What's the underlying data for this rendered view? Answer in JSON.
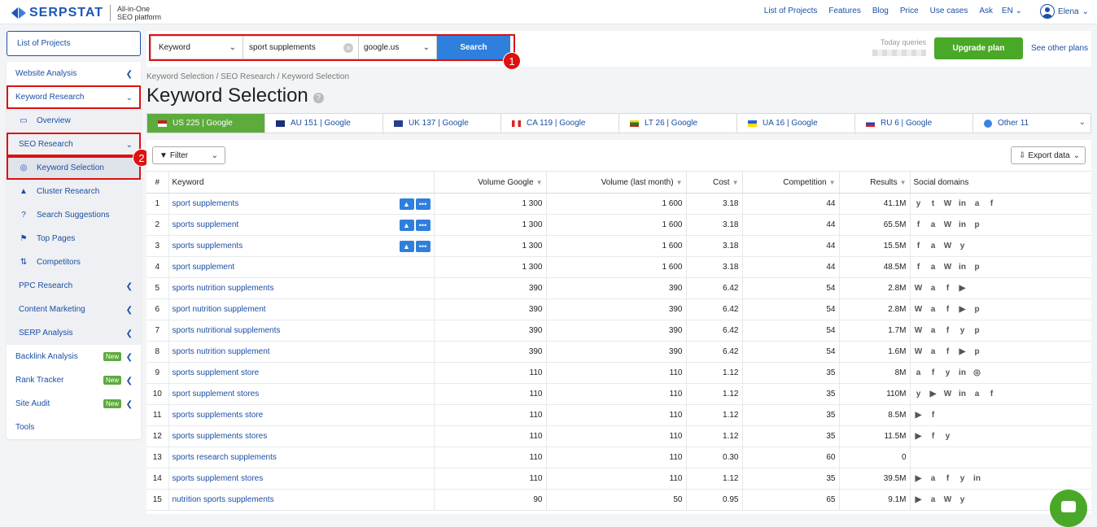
{
  "topbar": {
    "logo": "SERPSTAT",
    "tagline_1": "All-in-One",
    "tagline_2": "SEO platform",
    "nav": [
      "List of Projects",
      "Features",
      "Blog",
      "Price",
      "Use cases",
      "Ask"
    ],
    "lang": "EN",
    "user": "Elena"
  },
  "sidebar": {
    "projects": "List of Projects",
    "items": [
      {
        "label": "Website Analysis"
      },
      {
        "label": "Keyword Research"
      },
      {
        "label": "Overview"
      },
      {
        "label": "SEO Research"
      },
      {
        "label": "Keyword Selection"
      },
      {
        "label": "Cluster Research"
      },
      {
        "label": "Search Suggestions"
      },
      {
        "label": "Top Pages"
      },
      {
        "label": "Competitors"
      },
      {
        "label": "PPC Research"
      },
      {
        "label": "Content Marketing"
      },
      {
        "label": "SERP Analysis"
      },
      {
        "label": "Backlink Analysis",
        "badge": "New"
      },
      {
        "label": "Rank Tracker",
        "badge": "New"
      },
      {
        "label": "Site Audit",
        "badge": "New"
      },
      {
        "label": "Tools"
      }
    ]
  },
  "markers": {
    "one": "1",
    "two": "2"
  },
  "search": {
    "type": "Keyword",
    "query": "sport supplements",
    "engine": "google.us",
    "button": "Search",
    "today_queries": "Today queries",
    "upgrade": "Upgrade plan",
    "other_plans": "See other plans"
  },
  "breadcrumb": "Keyword Selection / SEO Research / Keyword Selection",
  "title": "Keyword Selection",
  "country_tabs": [
    "US 225 | Google",
    "AU 151 | Google",
    "UK 137 | Google",
    "CA 119 | Google",
    "LT 26 | Google",
    "UA 16 | Google",
    "RU 6 | Google",
    "Other 11"
  ],
  "filter": "Filter",
  "export": "Export data",
  "table": {
    "headers": [
      "#",
      "Keyword",
      "Volume Google",
      "Volume (last month)",
      "Cost",
      "Competition",
      "Results",
      "Social domains"
    ],
    "rows": [
      {
        "n": "1",
        "kw": "sport supplements",
        "vg": "1 300",
        "vl": "1 600",
        "cost": "3.18",
        "comp": "44",
        "res": "41.1M",
        "soc": "y t W in a f",
        "btns": true
      },
      {
        "n": "2",
        "kw": "sports supplement",
        "vg": "1 300",
        "vl": "1 600",
        "cost": "3.18",
        "comp": "44",
        "res": "65.5M",
        "soc": "f a W in p",
        "btns": true
      },
      {
        "n": "3",
        "kw": "sports supplements",
        "vg": "1 300",
        "vl": "1 600",
        "cost": "3.18",
        "comp": "44",
        "res": "15.5M",
        "soc": "f a W y",
        "btns": true
      },
      {
        "n": "4",
        "kw": "sport supplement",
        "vg": "1 300",
        "vl": "1 600",
        "cost": "3.18",
        "comp": "44",
        "res": "48.5M",
        "soc": "f a W in p"
      },
      {
        "n": "5",
        "kw": "sports nutrition supplements",
        "vg": "390",
        "vl": "390",
        "cost": "6.42",
        "comp": "54",
        "res": "2.8M",
        "soc": "W a f ▶"
      },
      {
        "n": "6",
        "kw": "sport nutrition supplement",
        "vg": "390",
        "vl": "390",
        "cost": "6.42",
        "comp": "54",
        "res": "2.8M",
        "soc": "W a f ▶ p"
      },
      {
        "n": "7",
        "kw": "sports nutritional supplements",
        "vg": "390",
        "vl": "390",
        "cost": "6.42",
        "comp": "54",
        "res": "1.7M",
        "soc": "W a f y p"
      },
      {
        "n": "8",
        "kw": "sports nutrition supplement",
        "vg": "390",
        "vl": "390",
        "cost": "6.42",
        "comp": "54",
        "res": "1.6M",
        "soc": "W a f ▶ p"
      },
      {
        "n": "9",
        "kw": "sports supplement store",
        "vg": "110",
        "vl": "110",
        "cost": "1.12",
        "comp": "35",
        "res": "8M",
        "soc": "a f y in ◎"
      },
      {
        "n": "10",
        "kw": "sport supplement stores",
        "vg": "110",
        "vl": "110",
        "cost": "1.12",
        "comp": "35",
        "res": "110M",
        "soc": "y ▶ W in a f"
      },
      {
        "n": "11",
        "kw": "sports supplements store",
        "vg": "110",
        "vl": "110",
        "cost": "1.12",
        "comp": "35",
        "res": "8.5M",
        "soc": "▶ f"
      },
      {
        "n": "12",
        "kw": "sports supplements stores",
        "vg": "110",
        "vl": "110",
        "cost": "1.12",
        "comp": "35",
        "res": "11.5M",
        "soc": "▶ f y"
      },
      {
        "n": "13",
        "kw": "sports research supplements",
        "vg": "110",
        "vl": "110",
        "cost": "0.30",
        "comp": "60",
        "res": "0",
        "soc": ""
      },
      {
        "n": "14",
        "kw": "sports supplement stores",
        "vg": "110",
        "vl": "110",
        "cost": "1.12",
        "comp": "35",
        "res": "39.5M",
        "soc": "▶ a f y in"
      },
      {
        "n": "15",
        "kw": "nutrition sports supplements",
        "vg": "90",
        "vl": "50",
        "cost": "0.95",
        "comp": "65",
        "res": "9.1M",
        "soc": "▶ a W y"
      }
    ]
  },
  "colors": {
    "accent": "#1b4fa6",
    "green": "#4aa829",
    "red": "#dd1111"
  }
}
